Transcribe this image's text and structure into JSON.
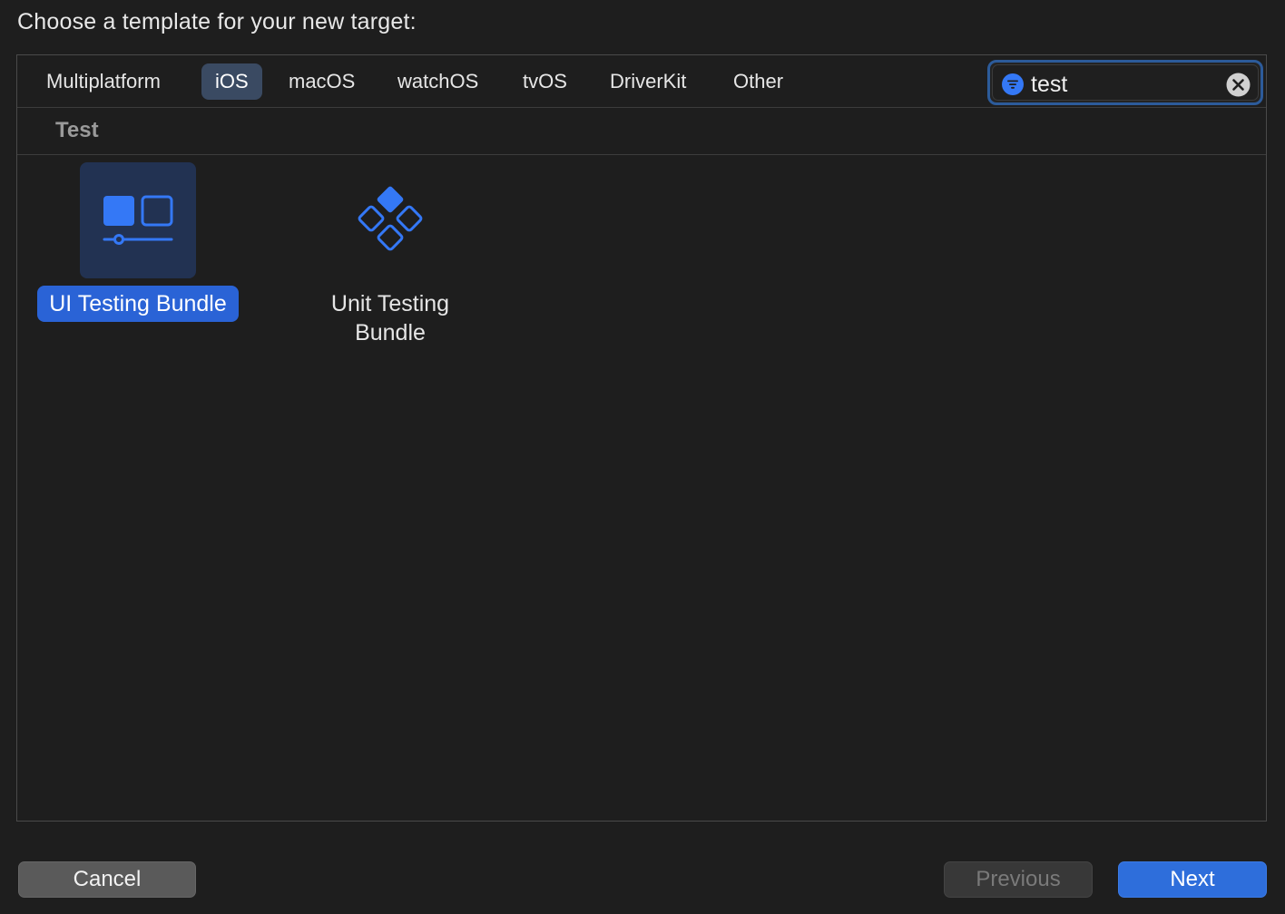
{
  "dialog": {
    "title": "Choose a template for your new target:"
  },
  "tabs": [
    {
      "label": "Multiplatform",
      "selected": false
    },
    {
      "label": "iOS",
      "selected": true
    },
    {
      "label": "macOS",
      "selected": false
    },
    {
      "label": "watchOS",
      "selected": false
    },
    {
      "label": "tvOS",
      "selected": false
    },
    {
      "label": "DriverKit",
      "selected": false
    },
    {
      "label": "Other",
      "selected": false
    }
  ],
  "search": {
    "value": "test",
    "filter_icon": "filter-icon",
    "clear_icon": "clear-icon"
  },
  "section": {
    "label": "Test"
  },
  "templates": [
    {
      "label": "UI Testing Bundle",
      "icon": "ui-testing-bundle-icon",
      "selected": true
    },
    {
      "label": "Unit Testing Bundle",
      "icon": "unit-testing-bundle-icon",
      "selected": false
    }
  ],
  "buttons": {
    "cancel": "Cancel",
    "previous": "Previous",
    "next": "Next"
  },
  "colors": {
    "accent": "#2e6edb",
    "selected_tab": "#3a4a62",
    "icon_blue": "#3478f6",
    "background": "#1e1e1e"
  }
}
